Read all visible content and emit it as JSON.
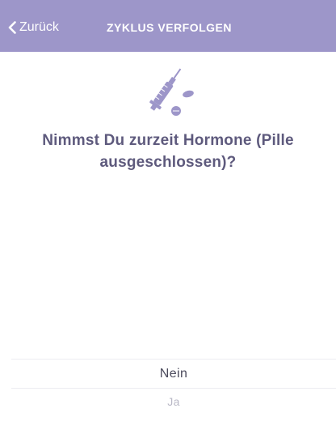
{
  "navbar": {
    "back_label": "Zurück",
    "title": "ZYKLUS VERFOLGEN",
    "background_color": "#9d96c9",
    "back_icon": "chevron-left-icon"
  },
  "content": {
    "icon": "syringe-pills-icon",
    "question": "Nimmst Du zurzeit Hormone (Pille ausgeschlossen)?"
  },
  "options": {
    "first": "Nein",
    "second": "Ja"
  },
  "colors": {
    "accent": "#9d96c9",
    "question_text": "#5e5a7d"
  }
}
